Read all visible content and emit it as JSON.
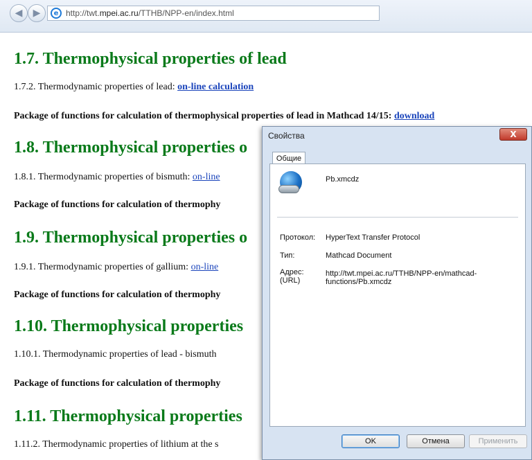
{
  "browser": {
    "url_prefix": "http://twt.",
    "url_domain": "mpei.ac.ru",
    "url_path": "/TTHB/NPP-en/index.html"
  },
  "page": {
    "h1_7": "1.7. Thermophysical properties of lead",
    "l172_text": "1.7.2. Thermodynamic properties of lead: ",
    "l172_link": "on-line calculation",
    "pkg17_text": "Package of functions for calculation of thermophysical properties of lead in Mathcad 14/15: ",
    "pkg17_link": "download",
    "h1_8": "1.8. Thermophysical properties o",
    "l181_text": "1.8.1. Thermodynamic properties of bismuth: ",
    "l181_link": "on-line",
    "pkg18_text": "Package of functions for calculation of thermophy",
    "h1_9": "1.9. Thermophysical properties o",
    "l191_text": "1.9.1. Thermodynamic properties of gallium: ",
    "l191_link": "on-line",
    "pkg19_text": "Package of functions for calculation of thermophy",
    "h1_10": "1.10. Thermophysical properties",
    "l1101_text": "1.10.1. Thermodynamic properties of lead - bismuth",
    "pkg110_text": "Package of functions for calculation of thermophy",
    "h1_11": "1.11. Thermophysical properties",
    "l1112_text": "1.11.2. Thermodynamic properties of lithium at the s"
  },
  "dialog": {
    "title": "Свойства",
    "close_glyph": "X",
    "tab_general": "Общие",
    "file_name": "Pb.xmcdz",
    "protocol_label": "Протокол:",
    "protocol_value": "HyperText Transfer Protocol",
    "type_label": "Тип:",
    "type_value": "Mathcad Document",
    "address_label_1": "Адрес:",
    "address_label_2": "(URL)",
    "address_value": "http://twt.mpei.ac.ru/TTHB/NPP-en/mathcad-functions/Pb.xmcdz",
    "ok_label": "OK",
    "cancel_label": "Отмена",
    "apply_label": "Применить"
  }
}
